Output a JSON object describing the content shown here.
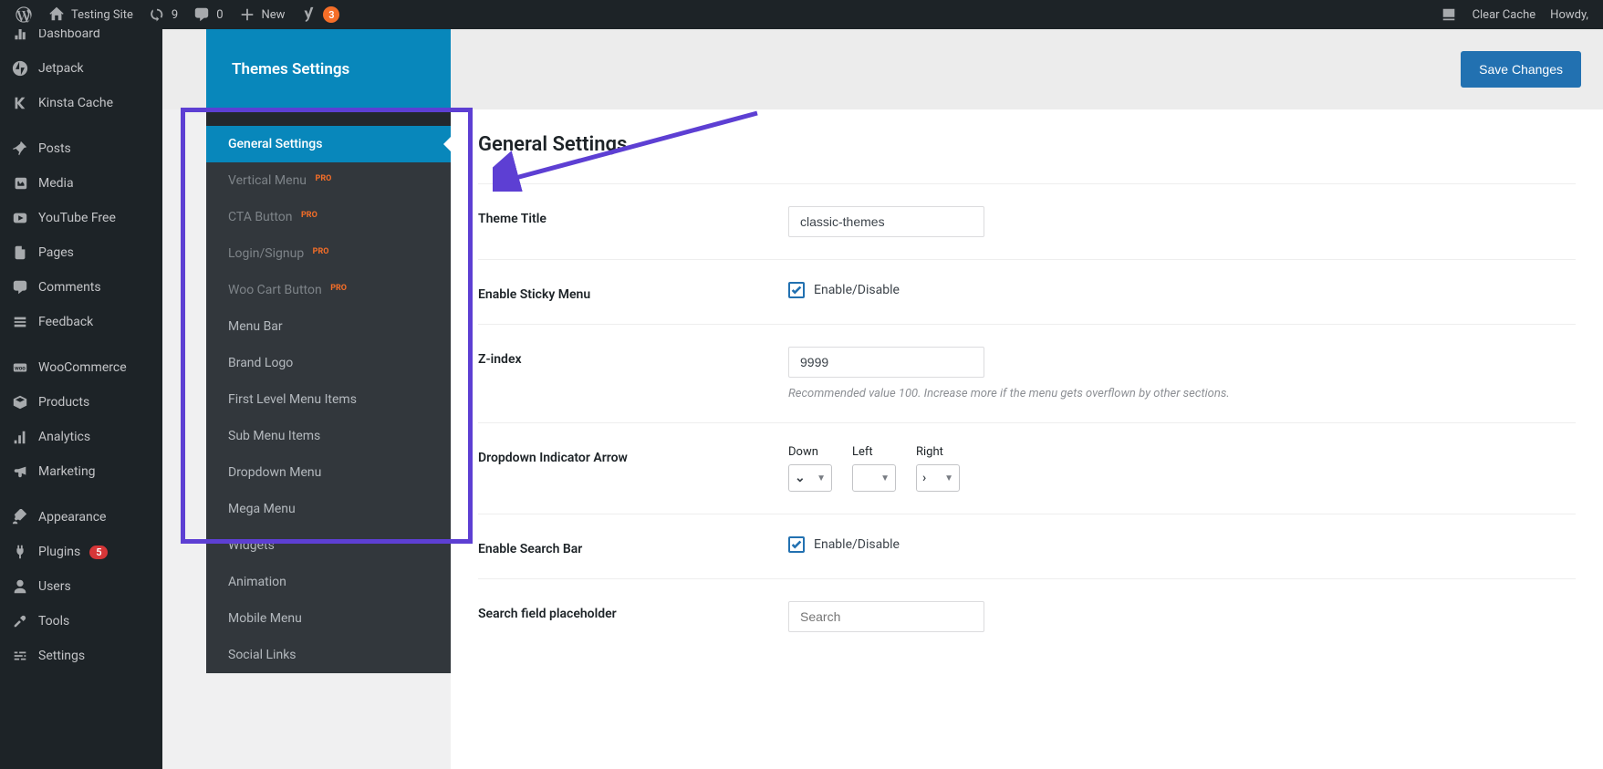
{
  "adminbar": {
    "site_name": "Testing Site",
    "updates_count": "9",
    "comments_count": "0",
    "new_label": "New",
    "yoast_count": "3",
    "clear_cache": "Clear Cache",
    "howdy": "Howdy,"
  },
  "wp_sidebar": {
    "dashboard": "Dashboard",
    "jetpack": "Jetpack",
    "kinsta": "Kinsta Cache",
    "posts": "Posts",
    "media": "Media",
    "youtube": "YouTube Free",
    "pages": "Pages",
    "comments": "Comments",
    "feedback": "Feedback",
    "woocommerce": "WooCommerce",
    "products": "Products",
    "analytics": "Analytics",
    "marketing": "Marketing",
    "appearance": "Appearance",
    "plugins": "Plugins",
    "plugins_count": "5",
    "users": "Users",
    "tools": "Tools",
    "settings": "Settings"
  },
  "page_header": {
    "title": "Themes Settings",
    "save": "Save Changes"
  },
  "sec_sidebar": {
    "pro": "PRO",
    "items": {
      "general": "General Settings",
      "vertical": "Vertical Menu",
      "cta": "CTA Button",
      "login": "Login/Signup",
      "woo": "Woo Cart Button",
      "menubar": "Menu Bar",
      "brand": "Brand Logo",
      "first": "First Level Menu Items",
      "sub": "Sub Menu Items",
      "dropdown": "Dropdown Menu",
      "mega": "Mega Menu",
      "widgets": "Widgets",
      "animation": "Animation",
      "mobile": "Mobile Menu",
      "social": "Social Links"
    }
  },
  "form": {
    "heading": "General Settings",
    "theme_title_label": "Theme Title",
    "theme_title_value": "classic-themes",
    "sticky_label": "Enable Sticky Menu",
    "enable_disable": "Enable/Disable",
    "zindex_label": "Z-index",
    "zindex_value": "9999",
    "zindex_help": "Recommended value 100. Increase more if the menu gets overflown by other sections.",
    "dropdown_label": "Dropdown Indicator Arrow",
    "down": "Down",
    "left": "Left",
    "right": "Right",
    "down_glyph": "⌄",
    "left_glyph": "",
    "right_glyph": "›",
    "search_label": "Enable Search Bar",
    "placeholder_label": "Search field placeholder",
    "placeholder_value": "Search"
  }
}
